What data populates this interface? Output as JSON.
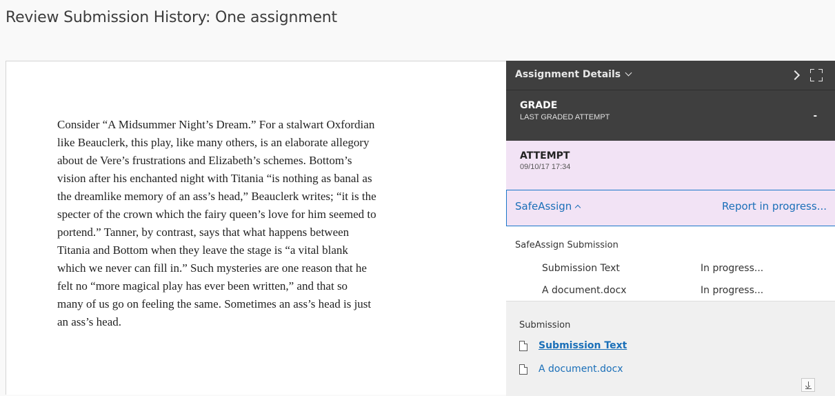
{
  "page": {
    "title": "Review Submission History: One assignment"
  },
  "document": {
    "text": "Consider “A Midsummer Night’s Dream.” For a stalwart Oxfordian\nlike Beauclerk, this play, like many others, is an elaborate allegory\nabout de Vere’s frustrations and Elizabeth’s schemes. Bottom’s\nvision after his enchanted night with Titania “is nothing as banal as\nthe dreamlike memory of an ass’s head,” Beauclerk writes; “it is the\nspecter of the crown which the fairy queen’s love for him seemed to\nportend.” Tanner, by contrast, says that what happens between\nTitania and Bottom when they leave the stage is “a vital blank\nwhich we never can fill in.” Such mysteries are one reason that he\nfelt no “more magical play has ever been written,” and that so\nmany of us go on feeling the same. Sometimes an ass’s head is just\nan ass’s head."
  },
  "sidebar": {
    "details_label": "Assignment Details",
    "icons": {
      "toggle": "chevron-down-icon",
      "next": "chevron-right-icon",
      "expand": "expand-icon"
    },
    "grade": {
      "title": "GRADE",
      "subtitle": "LAST GRADED ATTEMPT",
      "value": "-"
    },
    "attempt": {
      "title": "ATTEMPT",
      "date": "09/10/17 17:34"
    },
    "safeassign": {
      "label": "SafeAssign",
      "report": "Report in progress...",
      "heading": "SafeAssign Submission",
      "items": [
        {
          "name": "Submission Text",
          "status": "In progress..."
        },
        {
          "name": "A document.docx",
          "status": "In progress..."
        }
      ]
    },
    "submission": {
      "heading": "Submission",
      "files": [
        {
          "name": "Submission Text"
        },
        {
          "name": "A document.docx"
        }
      ]
    }
  },
  "colors": {
    "dark_bar": "#3f3f3f",
    "attempt_bg": "#f2e3f5",
    "link": "#1a6fb8",
    "focus_border": "#1a76c9"
  }
}
